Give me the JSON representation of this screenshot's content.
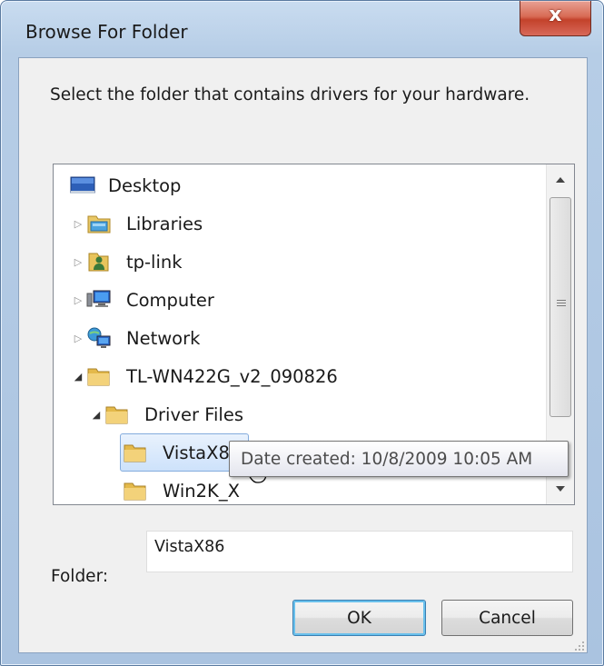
{
  "window": {
    "title": "Browse For Folder",
    "close_symbol": "x"
  },
  "prompt": "Select the folder that contains drivers for your hardware.",
  "tree": {
    "items": [
      {
        "label": "Desktop",
        "icon": "desktop-icon",
        "expander": ""
      },
      {
        "label": "Libraries",
        "icon": "libraries-icon",
        "expander": "▷"
      },
      {
        "label": "tp-link",
        "icon": "user-folder-icon",
        "expander": "▷"
      },
      {
        "label": "Computer",
        "icon": "computer-icon",
        "expander": "▷"
      },
      {
        "label": "Network",
        "icon": "network-icon",
        "expander": "▷"
      },
      {
        "label": "TL-WN422G_v2_090826",
        "icon": "folder-icon",
        "expander": "◢"
      },
      {
        "label": "Driver Files",
        "icon": "folder-icon",
        "expander": "◢"
      },
      {
        "label": "VistaX86",
        "icon": "folder-icon",
        "expander": ""
      },
      {
        "label": "Win2K_X",
        "icon": "folder-icon",
        "expander": ""
      }
    ],
    "selected": "VistaX86"
  },
  "tooltip": "Date created: 10/8/2009 10:05 AM",
  "folder": {
    "label": "Folder:",
    "value": "VistaX86"
  },
  "buttons": {
    "ok": "OK",
    "cancel": "Cancel"
  },
  "colors": {
    "selection": "#cde2fb",
    "accent_border": "#3c7fb1",
    "close_red": "#c3422b"
  }
}
